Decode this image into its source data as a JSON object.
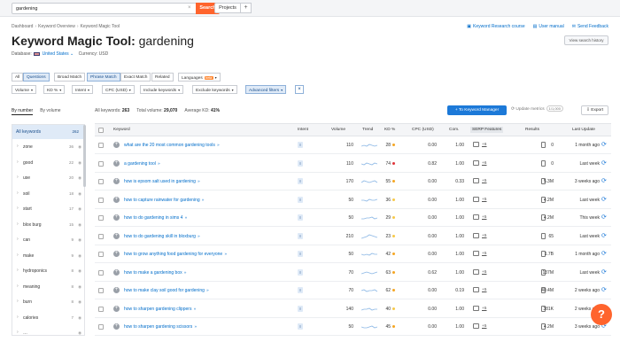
{
  "topbar": {
    "search_value": "gardening",
    "search_clear": "×",
    "search_button": "Search",
    "projects": "Projects",
    "add": "+"
  },
  "breadcrumb": [
    "Dashboard",
    "Keyword Overview",
    "Keyword Magic Tool"
  ],
  "breadcrumb_sep": "›",
  "links": {
    "research_course": "Keyword Research course",
    "user_manual": "User manual",
    "feedback": "Send Feedback"
  },
  "title": {
    "prefix": "Keyword Magic Tool:",
    "keyword": "gardening"
  },
  "view_history": "View search history",
  "database": {
    "label": "Database:",
    "value": "United States",
    "currency": "Currency: USD"
  },
  "match_buttons": [
    "All",
    "Questions",
    "Broad Match",
    "Phrase Match",
    "Exact Match",
    "Related"
  ],
  "languages": {
    "label": "Languages",
    "badge": "beta"
  },
  "filters": [
    "Volume",
    "KD %",
    "Intent",
    "CPC (USD)",
    "Include keywords",
    "Exclude keywords",
    "Advanced filters"
  ],
  "filter_clear": "×",
  "tabs": [
    "By number",
    "By volume"
  ],
  "summary": {
    "all_keywords_label": "All keywords:",
    "all_keywords": "263",
    "total_volume_label": "Total volume:",
    "total_volume": "29,070",
    "avg_kd_label": "Average KD:",
    "avg_kd": "41%"
  },
  "actions": {
    "to_manager": "+ To Keyword Manager",
    "update_metrics": "Update metrics",
    "update_count": "1/1,000",
    "export": "Export"
  },
  "sidebar": [
    {
      "label": "All keywords",
      "count": "262"
    },
    {
      "label": "zone",
      "count": "36"
    },
    {
      "label": "good",
      "count": "22"
    },
    {
      "label": "use",
      "count": "20"
    },
    {
      "label": "soil",
      "count": "18"
    },
    {
      "label": "start",
      "count": "17"
    },
    {
      "label": "blox burg",
      "count": "15"
    },
    {
      "label": "can",
      "count": "9"
    },
    {
      "label": "make",
      "count": "9"
    },
    {
      "label": "hydroponics",
      "count": "8"
    },
    {
      "label": "meaning",
      "count": "8"
    },
    {
      "label": "burn",
      "count": "8"
    },
    {
      "label": "calories",
      "count": "7"
    },
    {
      "label": "…",
      "count": ""
    }
  ],
  "columns": [
    "Keyword",
    "Intent",
    "Volume",
    "Trend",
    "KD %",
    "CPC (USD)",
    "Com.",
    "SERP Features",
    "Results",
    "Last Update"
  ],
  "intent_tag": "I",
  "colors": {
    "kd_high": "#e0353a",
    "kd_mid": "#f5a623",
    "kd_low": "#f7c948",
    "accent": "#1c79d8",
    "brand": "#ff642d"
  },
  "rows": [
    {
      "keyword": "what are the 20 most common gardening tools",
      "volume": "110",
      "kd": "28",
      "kd_color": "#f5a623",
      "cpc": "0.00",
      "com": "1.00",
      "serp": "+6",
      "results": "0",
      "update": "1 month ago"
    },
    {
      "keyword": "a gardening tool",
      "volume": "110",
      "kd": "74",
      "kd_color": "#e0353a",
      "cpc": "0.82",
      "com": "1.00",
      "serp": "+6",
      "results": "0",
      "update": "Last week"
    },
    {
      "keyword": "how is epsom salt used in gardening",
      "volume": "170",
      "kd": "55",
      "kd_color": "#f5a623",
      "cpc": "0.00",
      "com": "0.33",
      "serp": "+5",
      "results": "5.3M",
      "update": "3 weeks ago"
    },
    {
      "keyword": "how to capture rainwater for gardening",
      "volume": "50",
      "kd": "36",
      "kd_color": "#f7c948",
      "cpc": "0.00",
      "com": "1.00",
      "serp": "+5",
      "results": "4.2M",
      "update": "Last week"
    },
    {
      "keyword": "how to do gardening in sims 4",
      "volume": "50",
      "kd": "29",
      "kd_color": "#f7c948",
      "cpc": "0.00",
      "com": "1.00",
      "serp": "+5",
      "results": "4.2M",
      "update": "This week"
    },
    {
      "keyword": "how to do gardening skill in bloxburg",
      "volume": "210",
      "kd": "23",
      "kd_color": "#f7c948",
      "cpc": "0.00",
      "com": "1.00",
      "serp": "+5",
      "results": "65",
      "update": "Last week"
    },
    {
      "keyword": "how to grow anything food gardening for everyone",
      "volume": "50",
      "kd": "42",
      "kd_color": "#f5a623",
      "cpc": "0.00",
      "com": "1.00",
      "serp": "+5",
      "results": "1.7B",
      "update": "1 month ago"
    },
    {
      "keyword": "how to make a gardening box",
      "volume": "70",
      "kd": "63",
      "kd_color": "#f5a623",
      "cpc": "0.62",
      "com": "1.00",
      "serp": "+5",
      "results": "137M",
      "update": "Last week"
    },
    {
      "keyword": "how to make clay soil good for gardening",
      "volume": "70",
      "kd": "62",
      "kd_color": "#f5a623",
      "cpc": "0.00",
      "com": "0.19",
      "serp": "+5",
      "results": "40.4M",
      "update": "2 weeks ago"
    },
    {
      "keyword": "how to sharpen gardening clippers",
      "volume": "140",
      "kd": "40",
      "kd_color": "#f7c948",
      "cpc": "0.00",
      "com": "1.00",
      "serp": "+5",
      "results": "381K",
      "update": "2 weeks ago"
    },
    {
      "keyword": "how to sharpen gardening scissors",
      "volume": "50",
      "kd": "45",
      "kd_color": "#f5a623",
      "cpc": "0.00",
      "com": "1.00",
      "serp": "+5",
      "results": "4.2M",
      "update": "3 weeks ago"
    }
  ],
  "help_label": "?"
}
